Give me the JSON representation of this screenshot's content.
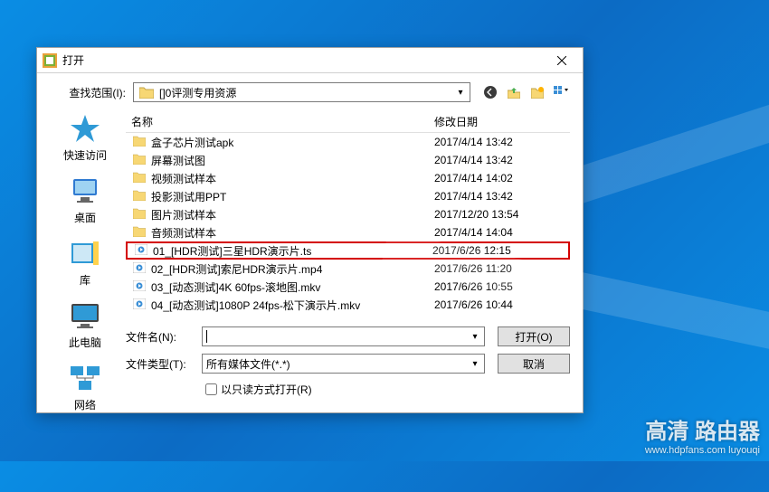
{
  "dialog": {
    "title": "打开",
    "look_in_label": "查找范围(I):",
    "current_folder": "[]0评测专用资源",
    "columns": {
      "name": "名称",
      "date": "修改日期"
    },
    "file_name_label": "文件名(N):",
    "file_type_label": "文件类型(T):",
    "file_type_value": "所有媒体文件(*.*)",
    "readonly_label": "以只读方式打开(R)",
    "open_button": "打开(O)",
    "cancel_button": "取消"
  },
  "places": [
    {
      "label": "快速访问",
      "icon": "★",
      "color": "#2f7ad1"
    },
    {
      "label": "桌面",
      "icon": "🖥",
      "color": "#2f7ad1"
    },
    {
      "label": "库",
      "icon": "📚",
      "color": "#2f7ad1"
    },
    {
      "label": "此电脑",
      "icon": "💻",
      "color": "#2f7ad1"
    },
    {
      "label": "网络",
      "icon": "🌐",
      "color": "#2f7ad1"
    }
  ],
  "files": [
    {
      "icon": "folder",
      "name": "盒子芯片测试apk",
      "date": "2017/4/14 13:42"
    },
    {
      "icon": "folder",
      "name": "屏幕测试图",
      "date": "2017/4/14 13:42"
    },
    {
      "icon": "folder",
      "name": "视频测试样本",
      "date": "2017/4/14 14:02"
    },
    {
      "icon": "folder",
      "name": "投影测试用PPT",
      "date": "2017/4/14 13:42"
    },
    {
      "icon": "folder",
      "name": "图片测试样本",
      "date": "2017/12/20 13:54"
    },
    {
      "icon": "folder",
      "name": "音频测试样本",
      "date": "2017/4/14 14:04"
    },
    {
      "icon": "video",
      "name": "01_[HDR测试]三星HDR演示片.ts",
      "date": "2017/6/26 12:15",
      "highlighted": true
    },
    {
      "icon": "video",
      "name": "02_[HDR测试]索尼HDR演示片.mp4",
      "date": "2017/6/26 11:20"
    },
    {
      "icon": "video",
      "name": "03_[动态测试]4K 60fps-滚地图.mkv",
      "date": "2017/6/26 10:55"
    },
    {
      "icon": "video",
      "name": "04_[动态测试]1080P 24fps-松下演示片.mkv",
      "date": "2017/6/26 10:44"
    }
  ],
  "watermark": {
    "main": "高清 路由器",
    "sub": "www.hdpfans.com  luyouqi"
  }
}
